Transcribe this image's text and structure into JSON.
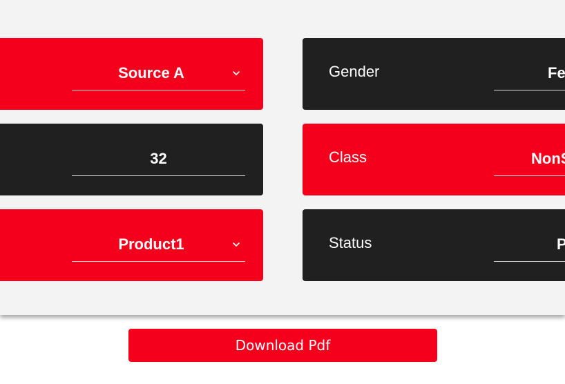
{
  "fields": {
    "source": {
      "value": "Source A",
      "icon": "chevron-down-icon"
    },
    "age": {
      "value": "32"
    },
    "product": {
      "value": "Product1",
      "icon": "chevron-down-icon"
    },
    "gender": {
      "label": "Gender",
      "value": "Fe"
    },
    "class": {
      "label": "Class",
      "value": "NonS"
    },
    "status": {
      "label": "Status",
      "value": "P"
    }
  },
  "actions": {
    "download_label": "Download Pdf"
  },
  "colors": {
    "accent": "#f5001c",
    "dark_card": "#202020",
    "panel_bg": "#f3f3f3"
  }
}
